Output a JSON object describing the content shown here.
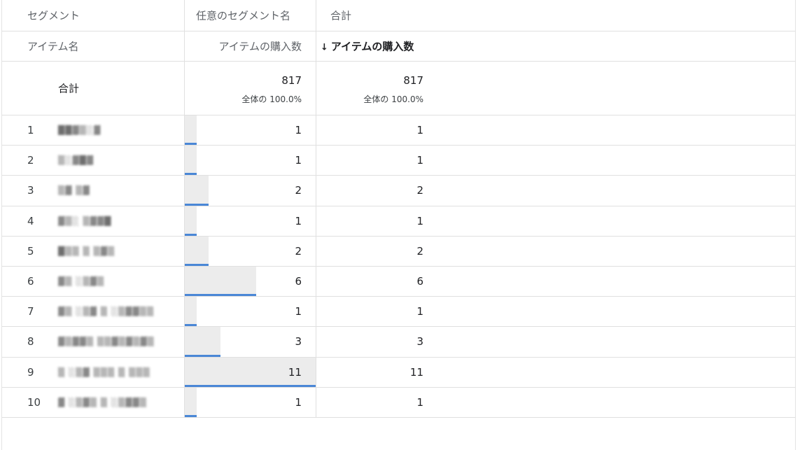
{
  "header": {
    "segment_label": "セグメント",
    "segment_name": "任意のセグメント名",
    "total_label": "合計",
    "item_name_label": "アイテム名",
    "metric_label": "アイテムの購入数",
    "metric_sorted_label": "アイテムの購入数",
    "sort_arrow": "↓"
  },
  "totals": {
    "label": "合計",
    "segment_value": "817",
    "segment_pct": "全体の 100.0%",
    "total_value": "817",
    "total_pct": "全体の 100.0%"
  },
  "max_value": 11,
  "rows": [
    {
      "index": "1",
      "item": "██▓▒░▓",
      "segment": "1",
      "total": "1",
      "value": 1
    },
    {
      "index": "2",
      "item": "▒░▓█▓",
      "segment": "1",
      "total": "1",
      "value": 1
    },
    {
      "index": "3",
      "item": "▒▓ ▒▓",
      "segment": "2",
      "total": "2",
      "value": 2
    },
    {
      "index": "4",
      "item": "▓▒░ ▒▓▓█",
      "segment": "1",
      "total": "1",
      "value": 1
    },
    {
      "index": "5",
      "item": "█▒▒ ▒ ▒▓▒",
      "segment": "2",
      "total": "2",
      "value": 2
    },
    {
      "index": "6",
      "item": "▓▒ ░▒▓▒",
      "segment": "6",
      "total": "6",
      "value": 6
    },
    {
      "index": "7",
      "item": "▓▒ ░▒▓ ▒ ░▒▓▓▒▒",
      "segment": "1",
      "total": "1",
      "value": 1
    },
    {
      "index": "8",
      "item": "▓▒▓▓▒ ▒▒▓▒▓▒▓▒",
      "segment": "3",
      "total": "3",
      "value": 3
    },
    {
      "index": "9",
      "item": "▒ ░▒▓ ▒▒▒ ▒ ▒▒▒",
      "segment": "11",
      "total": "11",
      "value": 11
    },
    {
      "index": "10",
      "item": "▓ ░▒▓▒ ▒ ░▒▓▓▒",
      "segment": "1",
      "total": "1",
      "value": 1
    }
  ],
  "colors": {
    "bar_fill": "#ececec",
    "bar_line": "#4a87d6",
    "grid": "#e0e0e0"
  }
}
